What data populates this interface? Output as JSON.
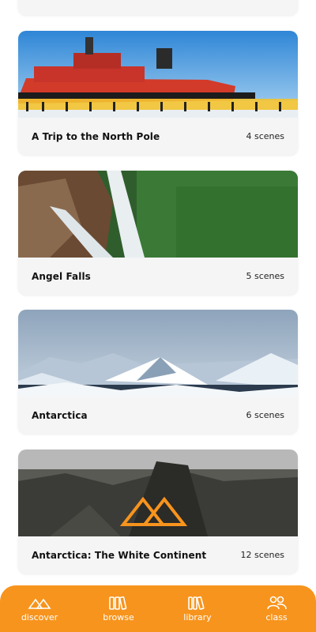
{
  "cards": [
    {
      "title": "A Trip to the North Pole",
      "scenes": "4 scenes",
      "image": "icebreaker-ship-photo"
    },
    {
      "title": "Angel Falls",
      "scenes": "5 scenes",
      "image": "waterfall-photo"
    },
    {
      "title": "Antarctica",
      "scenes": "6 scenes",
      "image": "snowy-mountains-photo"
    },
    {
      "title": "Antarctica: The White Continent",
      "scenes": "12 scenes",
      "image": "mountain-peak-photo"
    }
  ],
  "nav": {
    "discover": "discover",
    "browse": "browse",
    "library": "library",
    "class": "class"
  },
  "colors": {
    "accent": "#f7941d",
    "card_bg": "#f5f5f5"
  }
}
